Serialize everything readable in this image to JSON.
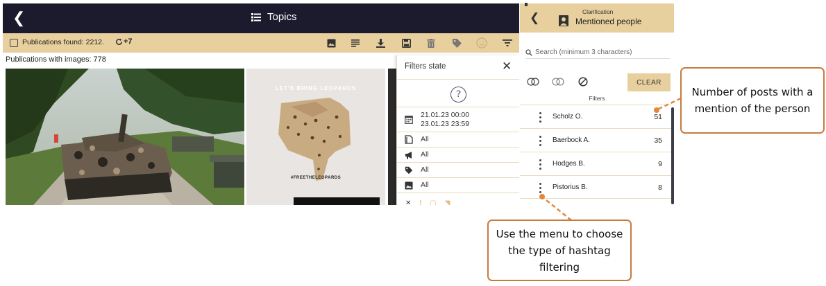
{
  "header": {
    "back_icon": "chevron-left-icon",
    "title_icon": "list-icon",
    "title": "Topics"
  },
  "toolbar": {
    "found_label": "Publications found: 2212.",
    "refresh_label": "+7",
    "icons": [
      "image-icon",
      "text-icon",
      "download-icon",
      "save-icon",
      "delete-icon",
      "tag-icon",
      "emoji-icon",
      "filter-icon"
    ],
    "accent": "#e8cf9e"
  },
  "content": {
    "images_count_label": "Publications with images: 778",
    "leopards_headline": "LET'S BRING LEOPARDS",
    "leopards_hashtag": "#FREETHELEOPARDS"
  },
  "filters_state": {
    "title": "Filters state",
    "date_from": "21.01.23 00:00",
    "date_to": "23.01.23 23:59",
    "rows": [
      {
        "icon": "document-icon",
        "value": "All"
      },
      {
        "icon": "megaphone-icon",
        "value": "All"
      },
      {
        "icon": "tag-icon",
        "value": "All"
      },
      {
        "icon": "image-icon",
        "value": "All"
      }
    ],
    "socials": [
      "x-icon",
      "facebook-icon",
      "instagram-icon",
      "twitter-icon"
    ]
  },
  "panel": {
    "subtitle": "Clarification",
    "title": "Mentioned people",
    "search_placeholder": "Search (minimum 3 characters)",
    "clear_label": "CLEAR",
    "filters_label": "Filters",
    "people": [
      {
        "name": "Scholz O.",
        "count": "51"
      },
      {
        "name": "Baerbock A.",
        "count": "35"
      },
      {
        "name": "Hodges B.",
        "count": "9"
      },
      {
        "name": "Pistorius B.",
        "count": "8"
      }
    ]
  },
  "callouts": {
    "count": "Number of posts with a mention of the person",
    "menu": "Use the menu to choose the type of hashtag filtering",
    "color": "#c97a3d"
  }
}
